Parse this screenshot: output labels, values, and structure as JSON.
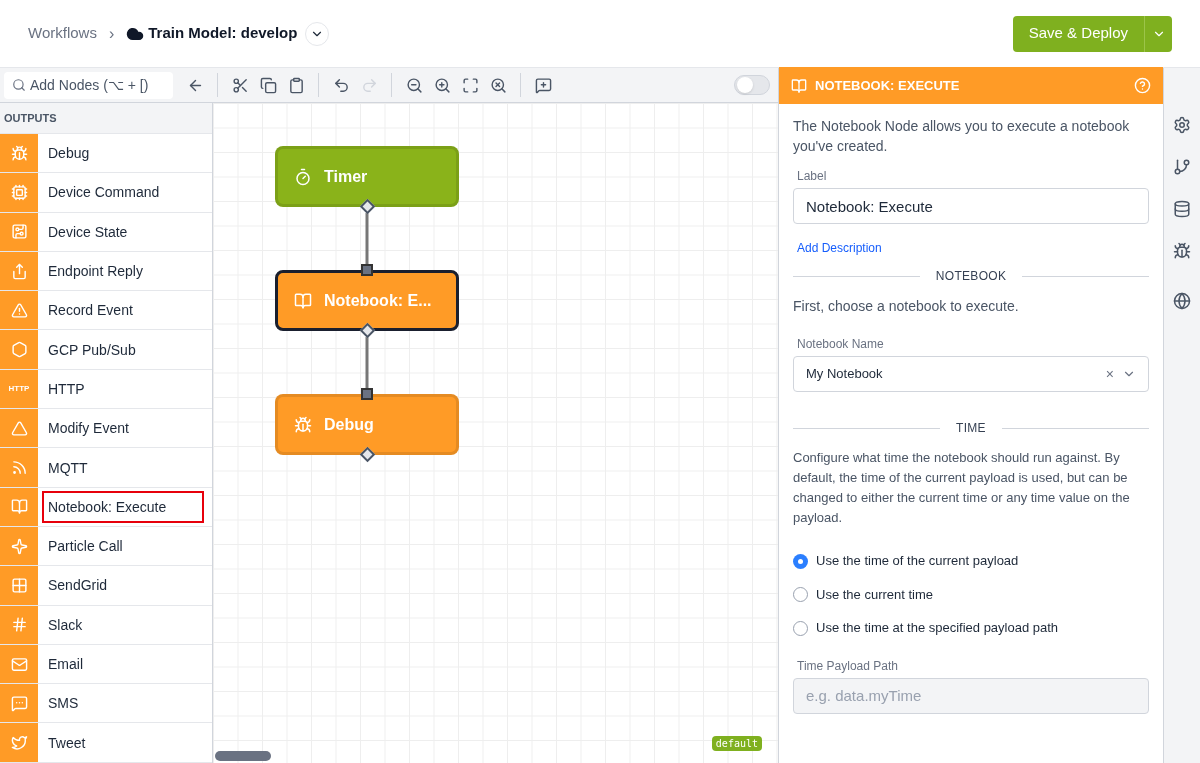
{
  "breadcrumb": {
    "parent": "Workflows",
    "separator": "›",
    "title": "Train Model: develop"
  },
  "deploy_button": "Save & Deploy",
  "toolbar": {
    "search": {
      "placeholder": "Add Nodes (⌥ + [)"
    },
    "toggle": {
      "on": false
    }
  },
  "sidebar": {
    "heading": "OUTPUTS",
    "items": [
      {
        "label": "Debug",
        "highlighted": false
      },
      {
        "label": "Device Command",
        "highlighted": false
      },
      {
        "label": "Device State",
        "highlighted": false
      },
      {
        "label": "Endpoint Reply",
        "highlighted": false
      },
      {
        "label": "Record Event",
        "highlighted": false
      },
      {
        "label": "GCP Pub/Sub",
        "highlighted": false
      },
      {
        "label": "HTTP",
        "badge": "HTTP",
        "highlighted": false
      },
      {
        "label": "Modify Event",
        "highlighted": false
      },
      {
        "label": "MQTT",
        "highlighted": false
      },
      {
        "label": "Notebook: Execute",
        "highlighted": true
      },
      {
        "label": "Particle Call",
        "highlighted": false
      },
      {
        "label": "SendGrid",
        "highlighted": false
      },
      {
        "label": "Slack",
        "highlighted": false
      },
      {
        "label": "Email",
        "highlighted": false
      },
      {
        "label": "SMS",
        "highlighted": false
      },
      {
        "label": "Tweet",
        "highlighted": false
      }
    ]
  },
  "canvas": {
    "nodes": [
      {
        "label": "Timer",
        "color": "#8ab31a",
        "selected": false
      },
      {
        "label": "Notebook: E...",
        "color": "#ff9b26",
        "selected": true
      },
      {
        "label": "Debug",
        "color": "#ff9b26",
        "selected": false
      }
    ],
    "tag": "default"
  },
  "panel": {
    "title": "NOTEBOOK: EXECUTE",
    "intro": "The Notebook Node allows you to execute a notebook you've created.",
    "label_field": {
      "label": "Label",
      "value": "Notebook: Execute"
    },
    "add_description": "Add Description",
    "notebook_section": "NOTEBOOK",
    "notebook_hint": "First, choose a notebook to execute.",
    "notebook_field": {
      "label": "Notebook Name",
      "value": "My Notebook",
      "clear": "×"
    },
    "time_section": "TIME",
    "time_hint": "Configure what time the notebook should run against. By default, the time of the current payload is used, but can be changed to either the current time or any time value on the payload.",
    "time_options": [
      {
        "label": "Use the time of the current payload",
        "selected": true
      },
      {
        "label": "Use the current time",
        "selected": false
      },
      {
        "label": "Use the time at the specified payload path",
        "selected": false
      }
    ],
    "path_field": {
      "label": "Time Payload Path",
      "placeholder": "e.g. data.myTime"
    }
  }
}
